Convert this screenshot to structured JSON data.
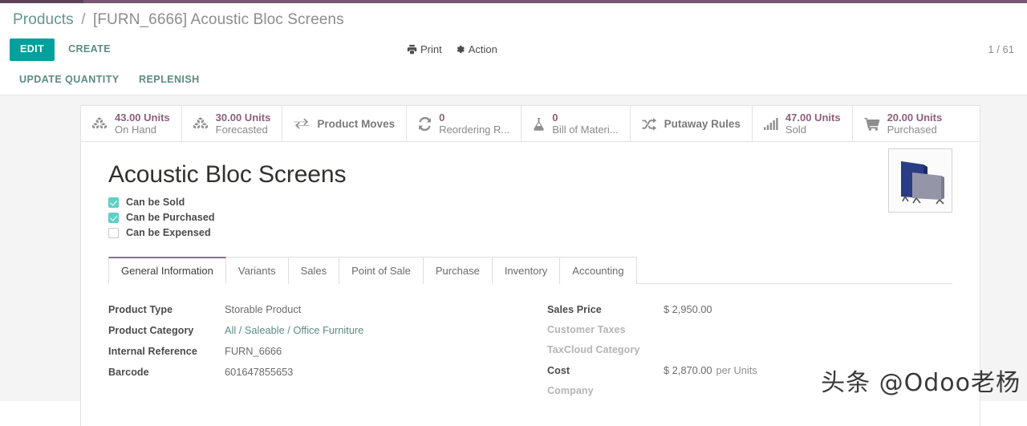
{
  "theme": {
    "brand_purple": "#7a5672",
    "brand_purple_dark": "#5e4159",
    "accent_teal": "#00a09d",
    "link_teal": "#5d8a85",
    "stat_value_color": "#8f5e7b",
    "checkbox_checked": "#5fd0c6",
    "active_tab_underline": "#9b6b8e"
  },
  "breadcrumb": {
    "root": "Products",
    "separator": "/",
    "current": "[FURN_6666] Acoustic Bloc Screens"
  },
  "control_panel": {
    "edit_label": "EDIT",
    "create_label": "CREATE",
    "print_label": "Print",
    "print_icon": "printer-icon",
    "action_label": "Action",
    "action_icon": "gear-icon",
    "pager": "1 / 61"
  },
  "secondary_bar": {
    "buttons": [
      {
        "label": "UPDATE QUANTITY"
      },
      {
        "label": "REPLENISH"
      }
    ]
  },
  "stat_buttons": [
    {
      "icon": "cubes-icon",
      "value": "43.00 Units",
      "label": "On Hand"
    },
    {
      "icon": "cubes-icon",
      "value": "30.00 Units",
      "label": "Forecasted"
    },
    {
      "icon": "exchange-arrows-icon",
      "single": "Product Moves"
    },
    {
      "icon": "refresh-icon",
      "value": "0",
      "label": "Reordering R..."
    },
    {
      "icon": "flask-icon",
      "value": "0",
      "label": "Bill of Materi..."
    },
    {
      "icon": "shuffle-icon",
      "single": "Putaway Rules"
    },
    {
      "icon": "signal-bars-icon",
      "value": "47.00 Units",
      "label": "Sold"
    },
    {
      "icon": "shopping-cart-icon",
      "value": "20.00 Units",
      "label": "Purchased"
    }
  ],
  "product": {
    "title": "Acoustic Bloc Screens",
    "image_alt": "acoustic-bloc-screens-photo",
    "checkboxes": [
      {
        "label": "Can be Sold",
        "checked": true
      },
      {
        "label": "Can be Purchased",
        "checked": true
      },
      {
        "label": "Can be Expensed",
        "checked": false
      }
    ]
  },
  "notebook": {
    "tabs": [
      {
        "label": "General Information",
        "active": true
      },
      {
        "label": "Variants",
        "active": false
      },
      {
        "label": "Sales",
        "active": false
      },
      {
        "label": "Point of Sale",
        "active": false
      },
      {
        "label": "Purchase",
        "active": false
      },
      {
        "label": "Inventory",
        "active": false
      },
      {
        "label": "Accounting",
        "active": false
      }
    ]
  },
  "form": {
    "left": [
      {
        "label": "Product Type",
        "value": "Storable Product",
        "style": "plain",
        "label_muted": false
      },
      {
        "label": "Product Category",
        "value": "All / Saleable / Office Furniture",
        "style": "link",
        "label_muted": false
      },
      {
        "label": "Internal Reference",
        "value": "FURN_6666",
        "style": "plain",
        "label_muted": false
      },
      {
        "label": "Barcode",
        "value": "601647855653",
        "style": "plain",
        "label_muted": false
      }
    ],
    "right": [
      {
        "label": "Sales Price",
        "value": "$ 2,950.00",
        "suffix": "",
        "style": "plain",
        "label_muted": false
      },
      {
        "label": "Customer Taxes",
        "value": "",
        "suffix": "",
        "style": "plain",
        "label_muted": true
      },
      {
        "label": "TaxCloud Category",
        "value": "",
        "suffix": "",
        "style": "plain",
        "label_muted": true
      },
      {
        "label": "Cost",
        "value": "$ 2,870.00",
        "suffix": "per Units",
        "style": "plain",
        "label_muted": false
      },
      {
        "label": "Company",
        "value": "",
        "suffix": "",
        "style": "plain",
        "label_muted": true
      }
    ]
  },
  "watermark": {
    "text": "头条 @Odoo老杨"
  }
}
